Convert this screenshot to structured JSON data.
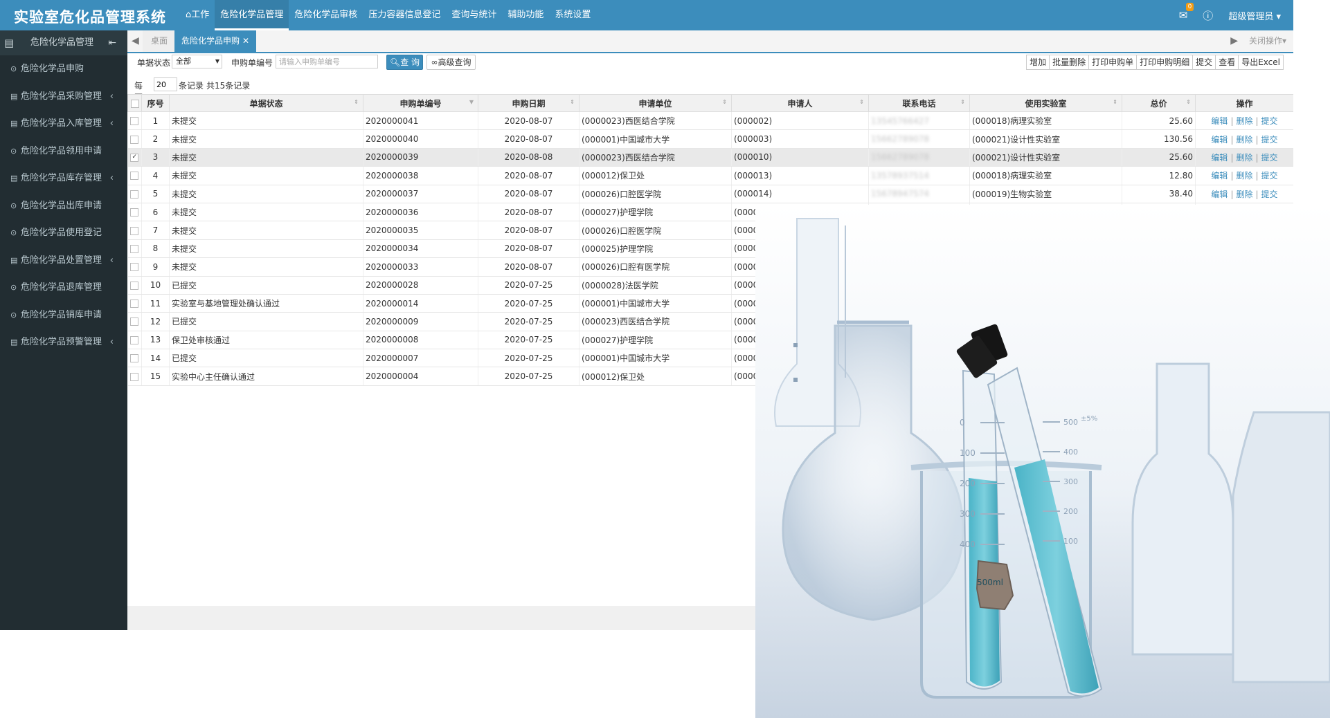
{
  "app": {
    "title": "实验室危化品管理系统"
  },
  "topnav": [
    {
      "label": "工作",
      "icon": "home-icon",
      "active": false
    },
    {
      "label": "危险化学品管理",
      "active": true
    },
    {
      "label": "危险化学品审核",
      "active": false
    },
    {
      "label": "压力容器信息登记",
      "active": false
    },
    {
      "label": "查询与统计",
      "active": false
    },
    {
      "label": "辅助功能",
      "active": false
    },
    {
      "label": "系统设置",
      "active": false
    }
  ],
  "topright": {
    "mail_badge": "0",
    "user": "超级管理员"
  },
  "sidebar": {
    "header": "危险化学品管理",
    "items": [
      {
        "label": "危险化学品申购",
        "icon": "circle-icon",
        "submenu": false
      },
      {
        "label": "危险化学品采购管理",
        "icon": "list-icon",
        "submenu": true
      },
      {
        "label": "危险化学品入库管理",
        "icon": "list-icon",
        "submenu": true
      },
      {
        "label": "危险化学品领用申请",
        "icon": "circle-icon",
        "submenu": false
      },
      {
        "label": "危险化学品库存管理",
        "icon": "list-icon",
        "submenu": true
      },
      {
        "label": "危险化学品出库申请",
        "icon": "circle-icon",
        "submenu": false
      },
      {
        "label": "危险化学品使用登记",
        "icon": "circle-icon",
        "submenu": false
      },
      {
        "label": "危险化学品处置管理",
        "icon": "list-icon",
        "submenu": true
      },
      {
        "label": "危险化学品退库管理",
        "icon": "circle-icon",
        "submenu": false
      },
      {
        "label": "危险化学品销库申请",
        "icon": "circle-icon",
        "submenu": false
      },
      {
        "label": "危险化学品预警管理",
        "icon": "list-icon",
        "submenu": true
      }
    ]
  },
  "tabs": {
    "home": "桌面",
    "current": "危险化学品申购",
    "close_ops": "关闭操作"
  },
  "filter": {
    "status_label": "单据状态",
    "status_value": "全部",
    "no_label": "申购单编号",
    "no_placeholder": "请输入申购单编号",
    "query_btn": "查 询",
    "advanced_btn": "高级查询"
  },
  "actions": [
    "增加",
    "批量删除",
    "打印申购单",
    "打印申购明细",
    "提交",
    "查看",
    "导出Excel"
  ],
  "pager": {
    "prefix": "每页",
    "page_size": "20",
    "suffix": "条记录",
    "total": "共15条记录"
  },
  "table": {
    "columns": [
      "",
      "序号",
      "单据状态",
      "申购单编号",
      "申购日期",
      "申请单位",
      "申请人",
      "联系电话",
      "使用实验室",
      "总价",
      "操作"
    ],
    "rows": [
      {
        "no": "1",
        "status": "未提交",
        "code": "2020000041",
        "date": "2020-08-07",
        "unit": "(0000023)西医结合学院",
        "applicant": "(000002)",
        "phone": "13545766427",
        "lab": "(000018)病理实验室",
        "total": "25.60",
        "checked": false
      },
      {
        "no": "2",
        "status": "未提交",
        "code": "2020000040",
        "date": "2020-08-07",
        "unit": "(000001)中国城市大学",
        "applicant": "(000003)",
        "phone": "15662789078",
        "lab": "(000021)设计性实验室",
        "total": "130.56",
        "checked": false
      },
      {
        "no": "3",
        "status": "未提交",
        "code": "2020000039",
        "date": "2020-08-08",
        "unit": "(0000023)西医结合学院",
        "applicant": "(000010)",
        "phone": "15662789078",
        "lab": "(000021)设计性实验室",
        "total": "25.60",
        "checked": true
      },
      {
        "no": "4",
        "status": "未提交",
        "code": "2020000038",
        "date": "2020-08-07",
        "unit": "(000012)保卫处",
        "applicant": "(000013)",
        "phone": "13578937514",
        "lab": "(000018)病理实验室",
        "total": "12.80",
        "checked": false
      },
      {
        "no": "5",
        "status": "未提交",
        "code": "2020000037",
        "date": "2020-08-07",
        "unit": "(000026)口腔医学院",
        "applicant": "(000014)",
        "phone": "15678947574",
        "lab": "(000019)生物实验室",
        "total": "38.40",
        "checked": false
      },
      {
        "no": "6",
        "status": "未提交",
        "code": "2020000036",
        "date": "2020-08-07",
        "unit": "(000027)护理学院",
        "applicant": "(0000",
        "checked": false
      },
      {
        "no": "7",
        "status": "未提交",
        "code": "2020000035",
        "date": "2020-08-07",
        "unit": "(000026)口腔医学院",
        "applicant": "(0000",
        "checked": false
      },
      {
        "no": "8",
        "status": "未提交",
        "code": "2020000034",
        "date": "2020-08-07",
        "unit": "(000025)护理学院",
        "applicant": "(0000",
        "checked": false
      },
      {
        "no": "9",
        "status": "未提交",
        "code": "2020000033",
        "date": "2020-08-07",
        "unit": "(000026)口腔有医学院",
        "applicant": "(0000",
        "checked": false
      },
      {
        "no": "10",
        "status": "已提交",
        "code": "2020000028",
        "date": "2020-07-25",
        "unit": "(0000028)法医学院",
        "applicant": "(0000",
        "checked": false
      },
      {
        "no": "11",
        "status": "实验室与基地管理处确认通过",
        "code": "2020000014",
        "date": "2020-07-25",
        "unit": "(000001)中国城市大学",
        "applicant": "(0000",
        "checked": false
      },
      {
        "no": "12",
        "status": "已提交",
        "code": "2020000009",
        "date": "2020-07-25",
        "unit": "(000023)西医结合学院",
        "applicant": "(0000",
        "checked": false
      },
      {
        "no": "13",
        "status": "保卫处审核通过",
        "code": "2020000008",
        "date": "2020-07-25",
        "unit": "(000027)护理学院",
        "applicant": "(0000",
        "checked": false
      },
      {
        "no": "14",
        "status": "已提交",
        "code": "2020000007",
        "date": "2020-07-25",
        "unit": "(000001)中国城市大学",
        "applicant": "(0000",
        "checked": false
      },
      {
        "no": "15",
        "status": "实验中心主任确认通过",
        "code": "2020000004",
        "date": "2020-07-25",
        "unit": "(000012)保卫处",
        "applicant": "(0000",
        "checked": false
      }
    ],
    "ops": [
      "编辑",
      "删除",
      "提交"
    ]
  },
  "photo": {
    "beaker_label": "500ml",
    "beaker_marks": [
      "0",
      "100",
      "200",
      "300",
      "400"
    ],
    "scale_marks": [
      "500",
      "400",
      "300",
      "200",
      "100"
    ],
    "tolerance": "±5%"
  },
  "colors": {
    "topbar": "#3c8dbc",
    "sidebar": "#222d32",
    "link": "#3c8dbc"
  }
}
